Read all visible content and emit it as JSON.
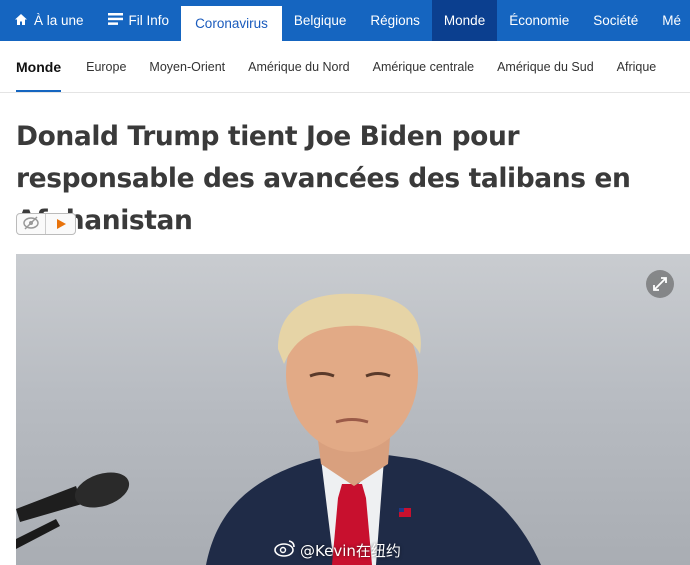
{
  "topnav": {
    "items": [
      {
        "label": "À la une",
        "icon": "home-icon"
      },
      {
        "label": "Fil Info",
        "icon": "list-icon"
      },
      {
        "label": "Coronavirus"
      },
      {
        "label": "Belgique"
      },
      {
        "label": "Régions"
      },
      {
        "label": "Monde"
      },
      {
        "label": "Économie"
      },
      {
        "label": "Société"
      },
      {
        "label": "Mé"
      }
    ]
  },
  "subnav": {
    "items": [
      "Monde",
      "Europe",
      "Moyen-Orient",
      "Amérique du Nord",
      "Amérique centrale",
      "Amérique du Sud",
      "Afrique"
    ]
  },
  "article": {
    "headline": "Donald Trump tient Joe Biden pour responsable des avancées des talibans en Afghanistan"
  },
  "watermark": {
    "text": "@Kevin在纽约"
  },
  "colors": {
    "brand": "#1565c0",
    "active_tab": "#0b3f8f"
  }
}
